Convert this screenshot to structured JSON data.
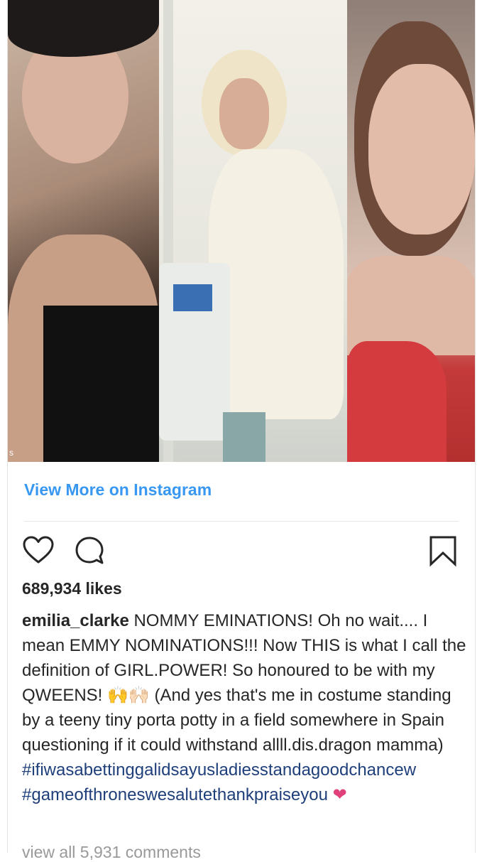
{
  "post": {
    "photo_watermark": "s",
    "view_more": "View More on Instagram",
    "likes": "689,934 likes",
    "username": "emilia_clarke",
    "caption_text": "NOMMY EMINATIONS! Oh no wait.... I mean EMMY NOMINATIONS!!! Now THIS is what I call the definition of GIRL.POWER! So honoured to be with my QWEENS! 🙌🙌🏻 (And yes that's me in costume standing by a teeny tiny porta potty in a field somewhere in Spain questioning if it could withstand allll.dis.dragon mamma)",
    "hashtag_1": "#ifiwasabettinggalidsayusladiesstandagoodchancew",
    "hashtag_2": "#gameofthroneswesalutethankpraiseyou",
    "heart_emoji": "❤",
    "comments_link": "view all 5,931 comments"
  },
  "icons": {
    "like": "heart-outline-icon",
    "comment": "comment-bubble-icon",
    "save": "bookmark-icon"
  },
  "colors": {
    "link": "#3897f0",
    "hashtag": "#1f3f7a",
    "heart": "#e0417a",
    "text": "#262626"
  }
}
